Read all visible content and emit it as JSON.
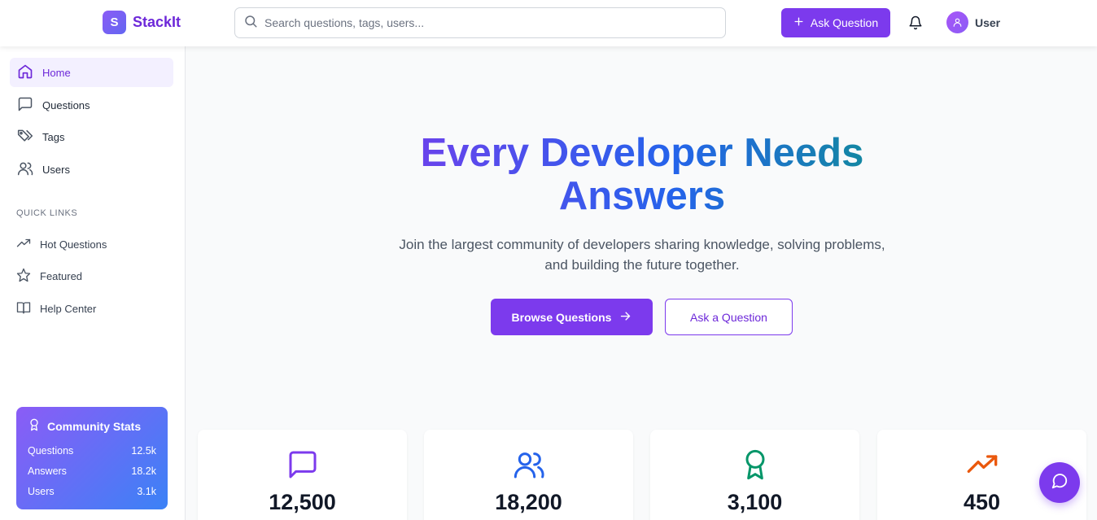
{
  "header": {
    "logo_letter": "S",
    "brand": "StackIt",
    "search_placeholder": "Search questions, tags, users...",
    "ask_label": "Ask Question",
    "user_name": "User"
  },
  "sidebar": {
    "nav": [
      {
        "label": "Home",
        "icon": "home-icon",
        "active": true
      },
      {
        "label": "Questions",
        "icon": "message-square-icon"
      },
      {
        "label": "Tags",
        "icon": "tags-icon"
      },
      {
        "label": "Users",
        "icon": "users-icon"
      }
    ],
    "quick_links_label": "QUICK LINKS",
    "quick_links": [
      {
        "label": "Hot Questions",
        "icon": "trending-up-icon"
      },
      {
        "label": "Featured",
        "icon": "star-icon"
      },
      {
        "label": "Help Center",
        "icon": "book-open-icon"
      }
    ],
    "community_stats": {
      "title": "Community Stats",
      "rows": [
        {
          "label": "Questions",
          "value": "12.5k"
        },
        {
          "label": "Answers",
          "value": "18.2k"
        },
        {
          "label": "Users",
          "value": "3.1k"
        }
      ]
    }
  },
  "hero": {
    "title_line1": "Every Developer Needs",
    "title_line2": "Answers",
    "subtitle": "Join the largest community of developers sharing knowledge, solving problems, and building the future together.",
    "browse_label": "Browse Questions",
    "ask_label": "Ask a Question"
  },
  "stats_cards": [
    {
      "value": "12,500",
      "icon": "message-square-icon",
      "color": "#7c3aed"
    },
    {
      "value": "18,200",
      "icon": "users-icon",
      "color": "#2563eb"
    },
    {
      "value": "3,100",
      "icon": "award-icon",
      "color": "#059669"
    },
    {
      "value": "450",
      "icon": "trending-up-icon",
      "color": "#ea580c"
    }
  ],
  "colors": {
    "accent": "#7c3aed",
    "accent_light": "#f3f0ff",
    "gradient_start": "#8b5cf6",
    "gradient_end": "#3b82f6"
  }
}
